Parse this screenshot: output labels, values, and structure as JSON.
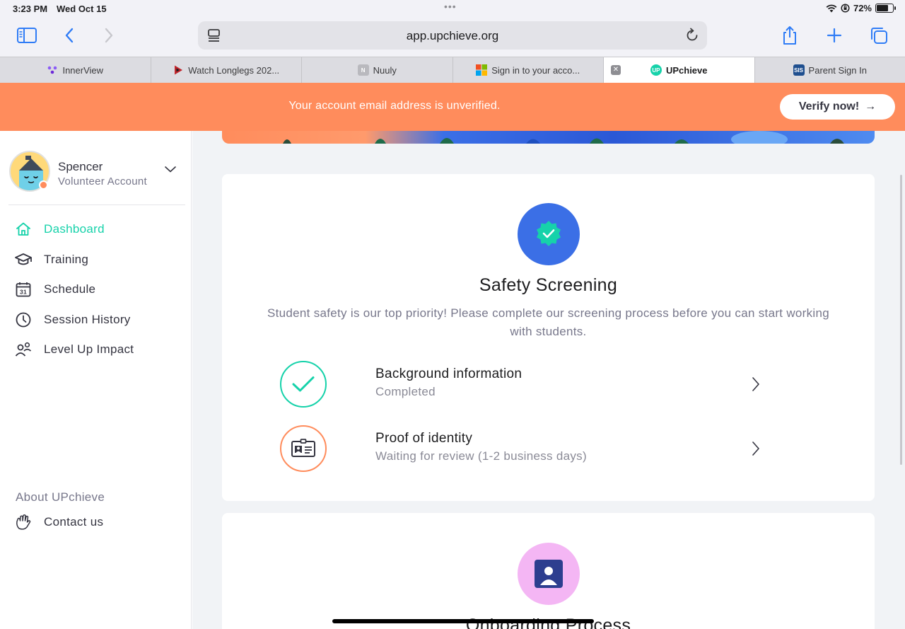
{
  "status_bar": {
    "time": "3:23 PM",
    "date": "Wed Oct 15",
    "battery": "72%",
    "battery_level": 0.72
  },
  "browser": {
    "url": "app.upchieve.org",
    "tabs": [
      {
        "label": "InnerView",
        "active": false
      },
      {
        "label": "Watch Longlegs 202...",
        "active": false
      },
      {
        "label": "Nuuly",
        "active": false
      },
      {
        "label": "Sign in to your acco...",
        "active": false
      },
      {
        "label": "UPchieve",
        "active": true
      },
      {
        "label": "Parent Sign In",
        "active": false
      }
    ],
    "favicons": {
      "nuuly": "N",
      "upchieve": "UP",
      "parent": "SIS"
    }
  },
  "banner": {
    "message": "Your account email address is unverified.",
    "button_label": "Verify now!",
    "arrow": "→",
    "color": "#ff8c5c"
  },
  "sidebar": {
    "user": {
      "name": "Spencer",
      "role": "Volunteer Account"
    },
    "nav": [
      {
        "label": "Dashboard",
        "icon": "home-icon",
        "active": true
      },
      {
        "label": "Training",
        "icon": "graduation-cap-icon",
        "active": false
      },
      {
        "label": "Schedule",
        "icon": "calendar-icon",
        "active": false
      },
      {
        "label": "Session History",
        "icon": "clock-icon",
        "active": false
      },
      {
        "label": "Level Up Impact",
        "icon": "people-icon",
        "active": false
      }
    ],
    "calendar_day": "31",
    "about_label": "About UPchieve",
    "contact_label": "Contact us"
  },
  "main": {
    "safety": {
      "title": "Safety Screening",
      "description": "Student safety is our top priority! Please complete our screening process before you can start working with students.",
      "steps": [
        {
          "title": "Background information",
          "status": "Completed",
          "icon": "check-icon"
        },
        {
          "title": "Proof of identity",
          "status": "Waiting for review (1-2 business days)",
          "icon": "id-card-icon"
        }
      ]
    },
    "onboarding": {
      "title": "Onboarding Process"
    }
  },
  "colors": {
    "accent_green": "#16d2aa",
    "accent_orange": "#ff8c5c",
    "badge_blue": "#3b6fe6",
    "badge_pink": "#f4b6f4"
  }
}
